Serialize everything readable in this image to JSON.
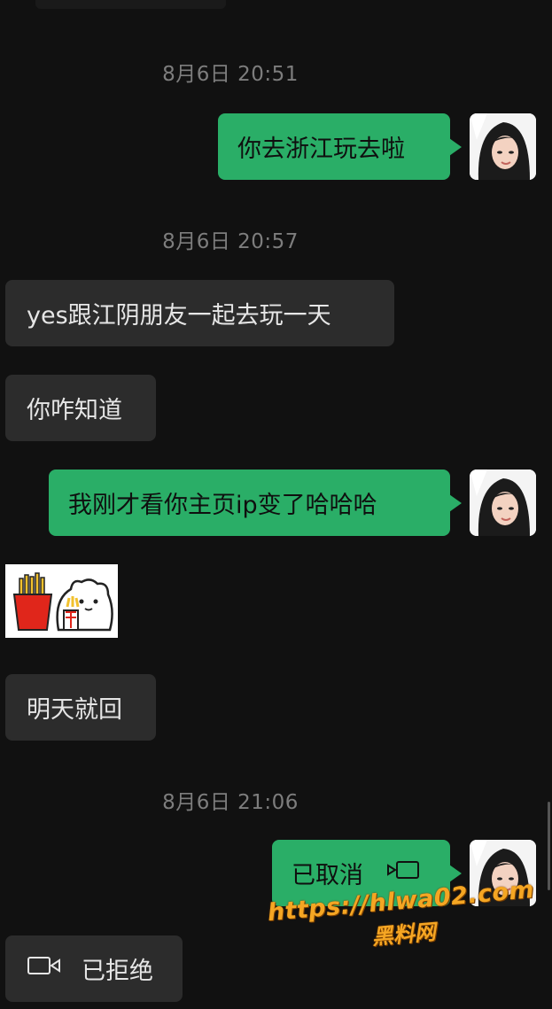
{
  "messages": {
    "ts1": "8月6日 20:51",
    "m1": "你去浙江玩去啦",
    "ts2": "8月6日 20:57",
    "m2": "yes跟江阴朋友一起去玩一天",
    "m3": "你咋知道",
    "m4": "我刚才看你主页ip变了哈哈哈",
    "m5": "明天就回",
    "ts3": "8月6日 21:06",
    "m6": "已取消",
    "m7": "已拒绝"
  },
  "watermark": {
    "url": "https://hlwa02.com",
    "name": "黑料网"
  },
  "colors": {
    "background": "#111111",
    "incoming_bubble": "#2c2c2c",
    "outgoing_bubble": "#2aae67",
    "timestamp": "#7d7d7d",
    "watermark": "#f5a623"
  },
  "icons": [
    "video-call-icon",
    "video-call-icon",
    "avatar",
    "sticker"
  ]
}
